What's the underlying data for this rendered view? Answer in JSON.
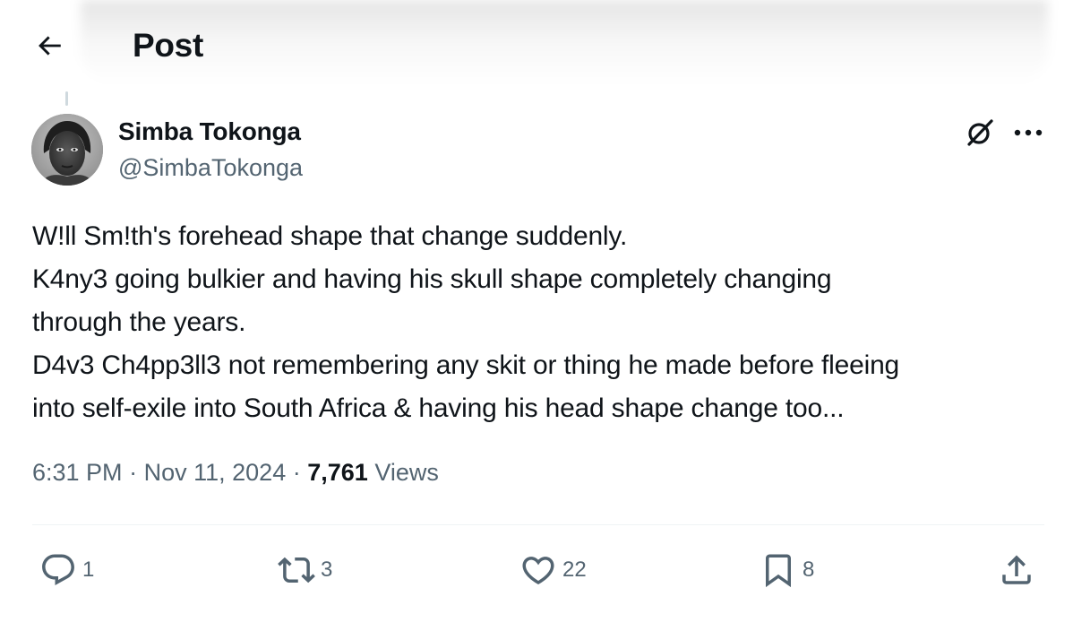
{
  "header": {
    "back_label": "back",
    "title": "Post"
  },
  "post": {
    "author": {
      "display_name": "Simba Tokonga",
      "handle": "@SimbaTokonga",
      "avatar": "avatar-photo"
    },
    "text_lines": [
      "W!ll Sm!th's forehead shape that change suddenly.",
      "K4ny3 going bulkier and having his skull shape completely changing",
      "through the years.",
      "D4v3 Ch4pp3ll3 not remembering any skit or thing he made before fleeing",
      "into self-exile into South Africa & having his head shape change too..."
    ],
    "time": "6:31 PM",
    "separator": "·",
    "date": "Nov 11, 2024",
    "views_count": "7,761",
    "views_label": "Views"
  },
  "actions": {
    "reply": {
      "icon": "reply-icon",
      "count": "1"
    },
    "repost": {
      "icon": "repost-icon",
      "count": "3"
    },
    "like": {
      "icon": "heart-icon",
      "count": "22"
    },
    "bookmark": {
      "icon": "bookmark-icon",
      "count": "8"
    },
    "share": {
      "icon": "share-icon"
    }
  },
  "icons": {
    "back": "arrow-left-icon",
    "grok": "grok-icon",
    "more": "more-horizontal-icon"
  },
  "colors": {
    "text_primary": "#0f1419",
    "text_secondary": "#536471",
    "divider": "#eff3f4",
    "thread_line": "#cfd9de"
  }
}
